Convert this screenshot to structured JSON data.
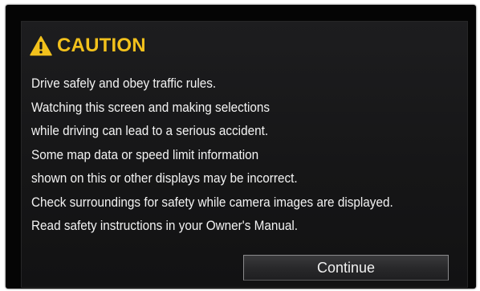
{
  "dialog": {
    "title": "CAUTION",
    "icon": "warning-triangle-icon",
    "accent_color": "#f2c11c",
    "messages": [
      "Drive safely and obey traffic rules.",
      "Watching this screen and making selections",
      "while driving can lead to a serious accident.",
      "Some map data or speed limit information",
      "shown on this or other displays may be incorrect.",
      "Check surroundings for safety while camera images are displayed.",
      "Read safety instructions in your Owner's Manual."
    ],
    "continue_label": "Continue"
  }
}
